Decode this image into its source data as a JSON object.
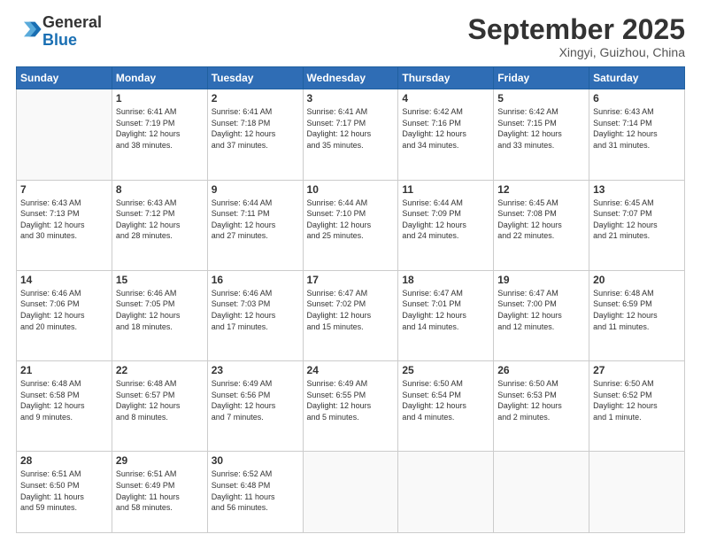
{
  "header": {
    "logo": {
      "line1": "General",
      "line2": "Blue"
    },
    "title": "September 2025",
    "location": "Xingyi, Guizhou, China"
  },
  "weekdays": [
    "Sunday",
    "Monday",
    "Tuesday",
    "Wednesday",
    "Thursday",
    "Friday",
    "Saturday"
  ],
  "weeks": [
    [
      {
        "day": "",
        "info": ""
      },
      {
        "day": "1",
        "info": "Sunrise: 6:41 AM\nSunset: 7:19 PM\nDaylight: 12 hours\nand 38 minutes."
      },
      {
        "day": "2",
        "info": "Sunrise: 6:41 AM\nSunset: 7:18 PM\nDaylight: 12 hours\nand 37 minutes."
      },
      {
        "day": "3",
        "info": "Sunrise: 6:41 AM\nSunset: 7:17 PM\nDaylight: 12 hours\nand 35 minutes."
      },
      {
        "day": "4",
        "info": "Sunrise: 6:42 AM\nSunset: 7:16 PM\nDaylight: 12 hours\nand 34 minutes."
      },
      {
        "day": "5",
        "info": "Sunrise: 6:42 AM\nSunset: 7:15 PM\nDaylight: 12 hours\nand 33 minutes."
      },
      {
        "day": "6",
        "info": "Sunrise: 6:43 AM\nSunset: 7:14 PM\nDaylight: 12 hours\nand 31 minutes."
      }
    ],
    [
      {
        "day": "7",
        "info": "Sunrise: 6:43 AM\nSunset: 7:13 PM\nDaylight: 12 hours\nand 30 minutes."
      },
      {
        "day": "8",
        "info": "Sunrise: 6:43 AM\nSunset: 7:12 PM\nDaylight: 12 hours\nand 28 minutes."
      },
      {
        "day": "9",
        "info": "Sunrise: 6:44 AM\nSunset: 7:11 PM\nDaylight: 12 hours\nand 27 minutes."
      },
      {
        "day": "10",
        "info": "Sunrise: 6:44 AM\nSunset: 7:10 PM\nDaylight: 12 hours\nand 25 minutes."
      },
      {
        "day": "11",
        "info": "Sunrise: 6:44 AM\nSunset: 7:09 PM\nDaylight: 12 hours\nand 24 minutes."
      },
      {
        "day": "12",
        "info": "Sunrise: 6:45 AM\nSunset: 7:08 PM\nDaylight: 12 hours\nand 22 minutes."
      },
      {
        "day": "13",
        "info": "Sunrise: 6:45 AM\nSunset: 7:07 PM\nDaylight: 12 hours\nand 21 minutes."
      }
    ],
    [
      {
        "day": "14",
        "info": "Sunrise: 6:46 AM\nSunset: 7:06 PM\nDaylight: 12 hours\nand 20 minutes."
      },
      {
        "day": "15",
        "info": "Sunrise: 6:46 AM\nSunset: 7:05 PM\nDaylight: 12 hours\nand 18 minutes."
      },
      {
        "day": "16",
        "info": "Sunrise: 6:46 AM\nSunset: 7:03 PM\nDaylight: 12 hours\nand 17 minutes."
      },
      {
        "day": "17",
        "info": "Sunrise: 6:47 AM\nSunset: 7:02 PM\nDaylight: 12 hours\nand 15 minutes."
      },
      {
        "day": "18",
        "info": "Sunrise: 6:47 AM\nSunset: 7:01 PM\nDaylight: 12 hours\nand 14 minutes."
      },
      {
        "day": "19",
        "info": "Sunrise: 6:47 AM\nSunset: 7:00 PM\nDaylight: 12 hours\nand 12 minutes."
      },
      {
        "day": "20",
        "info": "Sunrise: 6:48 AM\nSunset: 6:59 PM\nDaylight: 12 hours\nand 11 minutes."
      }
    ],
    [
      {
        "day": "21",
        "info": "Sunrise: 6:48 AM\nSunset: 6:58 PM\nDaylight: 12 hours\nand 9 minutes."
      },
      {
        "day": "22",
        "info": "Sunrise: 6:48 AM\nSunset: 6:57 PM\nDaylight: 12 hours\nand 8 minutes."
      },
      {
        "day": "23",
        "info": "Sunrise: 6:49 AM\nSunset: 6:56 PM\nDaylight: 12 hours\nand 7 minutes."
      },
      {
        "day": "24",
        "info": "Sunrise: 6:49 AM\nSunset: 6:55 PM\nDaylight: 12 hours\nand 5 minutes."
      },
      {
        "day": "25",
        "info": "Sunrise: 6:50 AM\nSunset: 6:54 PM\nDaylight: 12 hours\nand 4 minutes."
      },
      {
        "day": "26",
        "info": "Sunrise: 6:50 AM\nSunset: 6:53 PM\nDaylight: 12 hours\nand 2 minutes."
      },
      {
        "day": "27",
        "info": "Sunrise: 6:50 AM\nSunset: 6:52 PM\nDaylight: 12 hours\nand 1 minute."
      }
    ],
    [
      {
        "day": "28",
        "info": "Sunrise: 6:51 AM\nSunset: 6:50 PM\nDaylight: 11 hours\nand 59 minutes."
      },
      {
        "day": "29",
        "info": "Sunrise: 6:51 AM\nSunset: 6:49 PM\nDaylight: 11 hours\nand 58 minutes."
      },
      {
        "day": "30",
        "info": "Sunrise: 6:52 AM\nSunset: 6:48 PM\nDaylight: 11 hours\nand 56 minutes."
      },
      {
        "day": "",
        "info": ""
      },
      {
        "day": "",
        "info": ""
      },
      {
        "day": "",
        "info": ""
      },
      {
        "day": "",
        "info": ""
      }
    ]
  ]
}
